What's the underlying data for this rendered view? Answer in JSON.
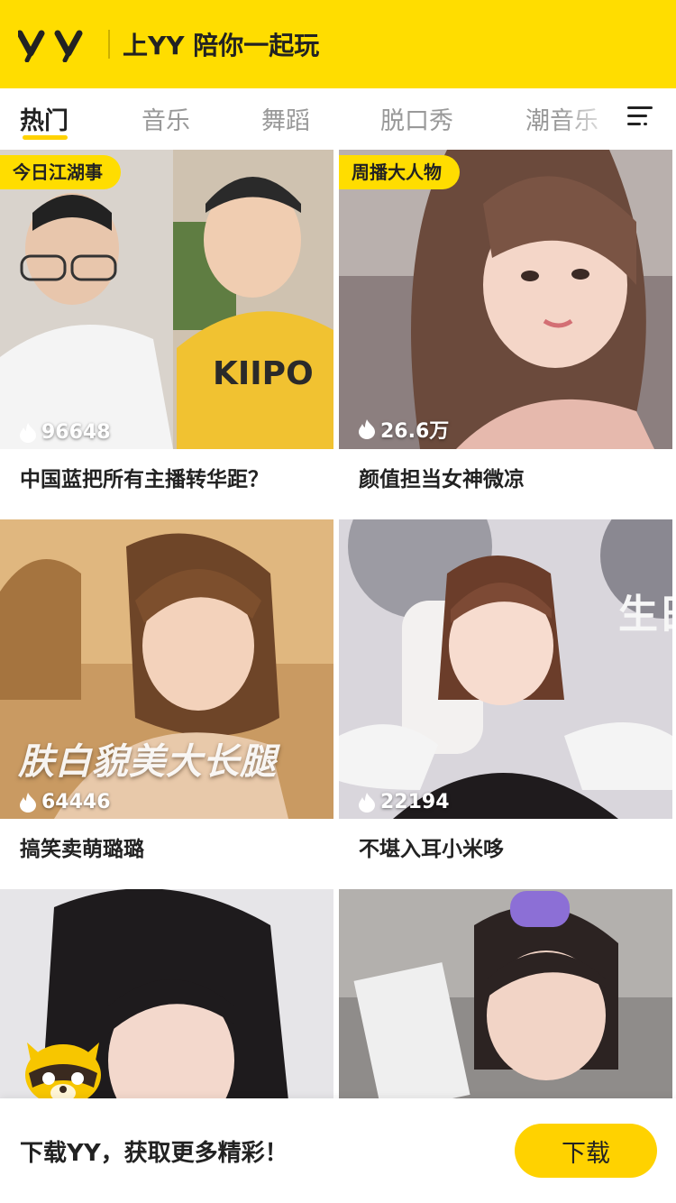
{
  "header": {
    "logo_text": "YY",
    "slogan": "上YY 陪你一起玩",
    "background_color": "#ffdd00"
  },
  "tabs": [
    {
      "label": "热门",
      "active": true
    },
    {
      "label": "音乐",
      "active": false
    },
    {
      "label": "舞蹈",
      "active": false
    },
    {
      "label": "脱口秀",
      "active": false
    },
    {
      "label": "潮音乐",
      "active": false
    }
  ],
  "cards": [
    {
      "badge": "今日江湖事",
      "viewers": "96648",
      "title": "中国蓝把所有主播转华距？",
      "overlay": ""
    },
    {
      "badge": "周播大人物",
      "viewers": "26.6万",
      "title": "颜值担当女神微凉",
      "overlay": ""
    },
    {
      "badge": "",
      "viewers": "64446",
      "title": "搞笑卖萌璐璐",
      "overlay": "肤白貌美大长腿"
    },
    {
      "badge": "",
      "viewers": "22194",
      "title": "不堪入耳小米哆",
      "overlay": ""
    },
    {
      "badge": "",
      "viewers": "",
      "title": "",
      "overlay": ""
    },
    {
      "badge": "",
      "viewers": "",
      "title": "",
      "overlay": ""
    }
  ],
  "banner": {
    "text": "下载YY，获取更多精彩！",
    "button_label": "下载"
  },
  "icons": {
    "menu": "menu-icon",
    "flame": "flame-icon",
    "mascot": "yy-raccoon-mascot-icon"
  },
  "accent_color": "#ffd200"
}
